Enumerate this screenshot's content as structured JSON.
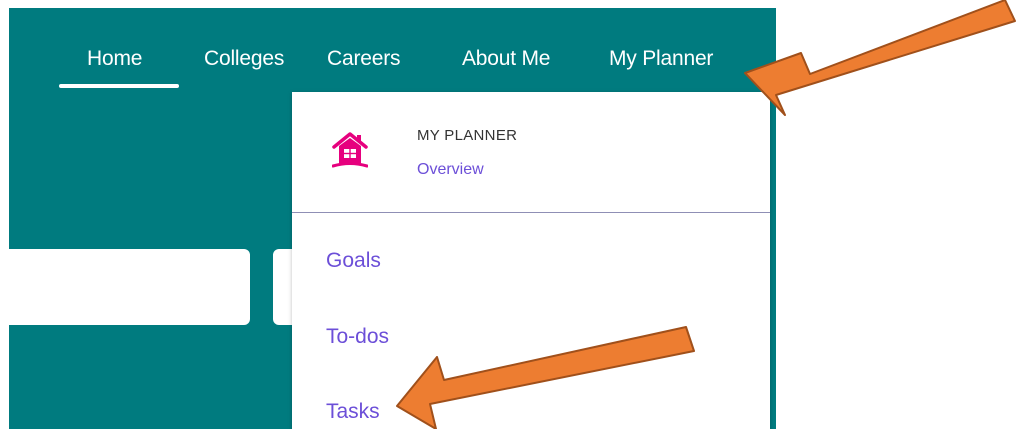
{
  "nav": {
    "items": [
      {
        "label": "Home"
      },
      {
        "label": "Colleges"
      },
      {
        "label": "Careers"
      },
      {
        "label": "About Me"
      },
      {
        "label": "My Planner"
      }
    ],
    "active": "Home"
  },
  "dropdown": {
    "title": "MY PLANNER",
    "overview_link": "Overview",
    "icon": "house-icon",
    "items": [
      {
        "label": "Goals"
      },
      {
        "label": "To-dos"
      },
      {
        "label": "Tasks"
      }
    ]
  },
  "annotations": {
    "arrow_color": "#ed7d31",
    "arrow_targets": [
      "My Planner",
      "Tasks"
    ]
  },
  "colors": {
    "header_bg": "#007b7f",
    "link": "#6c4fd8",
    "icon": "#e6007e"
  }
}
